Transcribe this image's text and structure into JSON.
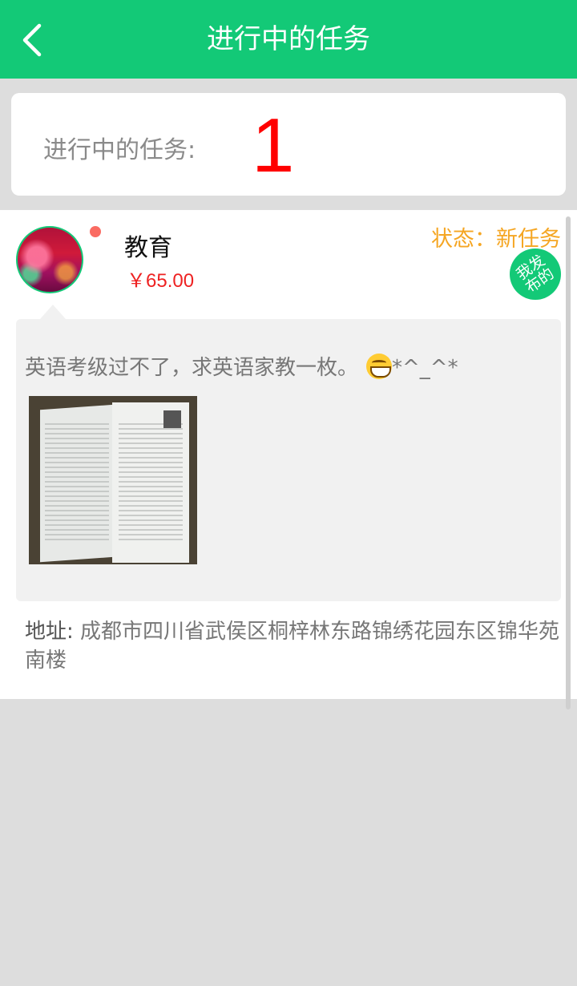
{
  "header": {
    "title": "进行中的任务"
  },
  "summary": {
    "label": "进行中的任务:",
    "count": "1"
  },
  "task": {
    "title": "教育",
    "price": "￥65.00",
    "status": "状态：新任务",
    "badge": "我发布的",
    "description": "英语考级过不了，求英语家教一枚。",
    "description_suffix": "*^_^*",
    "address_label": "地址:",
    "address": "成都市四川省武侯区桐梓林东路锦绣花园东区锦华苑南楼"
  },
  "icons": {
    "back": "chevron-left-icon",
    "emoji": "grinning-face-icon"
  },
  "colors": {
    "header_bg": "#13c977",
    "count": "#ff0000",
    "status": "#f5a623",
    "price": "#ee2222",
    "unread_dot": "#fa6b62"
  }
}
